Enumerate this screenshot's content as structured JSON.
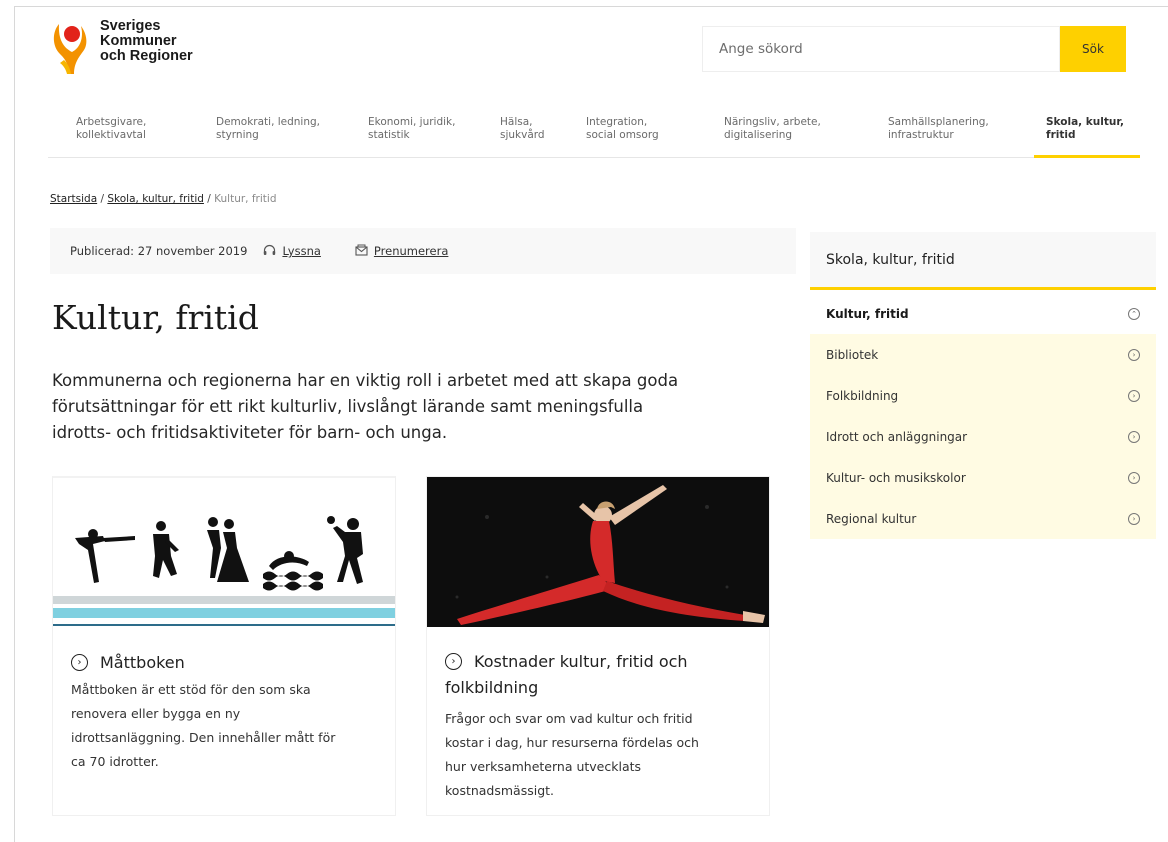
{
  "header": {
    "logo_lines": [
      "Sveriges",
      "Kommuner",
      "och Regioner"
    ],
    "search_placeholder": "Ange sökord",
    "search_button": "Sök"
  },
  "nav": {
    "items": [
      {
        "label": "Arbetsgivare,\nkollektivavtal"
      },
      {
        "label": "Demokrati, ledning,\nstyrning"
      },
      {
        "label": "Ekonomi, juridik,\nstatistik"
      },
      {
        "label": "Hälsa,\nsjukvård"
      },
      {
        "label": "Integration,\nsocial omsorg"
      },
      {
        "label": "Näringsliv, arbete,\ndigitalisering"
      },
      {
        "label": "Samhällsplanering,\ninfrastruktur"
      },
      {
        "label": "Skola, kultur,\nfritid"
      }
    ],
    "active_index": 7
  },
  "breadcrumb": {
    "home": "Startsida",
    "parent": "Skola, kultur, fritid",
    "separator": "/",
    "current": "Kultur, fritid"
  },
  "meta": {
    "published": "Publicerad: 27 november 2019",
    "listen": "Lyssna",
    "subscribe": "Prenumerera"
  },
  "page": {
    "title": "Kultur, fritid",
    "lead": "Kommunerna och regionerna har en viktig roll i arbetet med att skapa goda förutsättningar för ett rikt kulturliv, livslångt lärande samt meningsfulla idrotts- och fritidsaktiviteter för barn- och unga."
  },
  "cards": [
    {
      "title": "Måttboken",
      "description_lines": [
        "Måttboken är ett stöd för den som ska",
        "renovera eller bygga en ny",
        "idrottsanläggning. Den innehåller mått för",
        "ca 70 idrotter."
      ]
    },
    {
      "title_lines": [
        "Kostnader kultur, fritid och",
        "folkbildning"
      ],
      "description_lines": [
        "Frågor och svar om vad kultur och fritid",
        "kostar i dag, hur resurserna fördelas och",
        "hur verksamheterna utvecklats",
        "kostnadsmässigt."
      ]
    }
  ],
  "sidebar": {
    "heading": "Skola, kultur, fritid",
    "current": "Kultur, fritid",
    "items": [
      "Bibliotek",
      "Folkbildning",
      "Idrott och anläggningar",
      "Kultur- och musikskolor",
      "Regional kultur"
    ]
  },
  "colors": {
    "accent": "#fed000",
    "sidebar_sub_bg": "#fffbe3",
    "logo_orange": "#f39200",
    "logo_red": "#e2231a"
  }
}
